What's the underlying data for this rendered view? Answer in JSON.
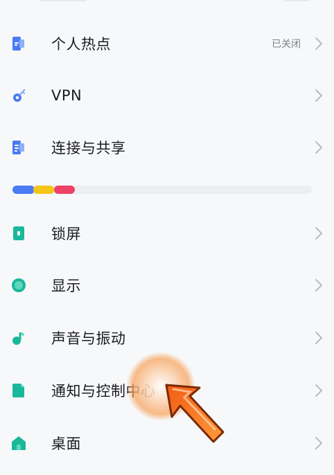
{
  "settings": {
    "section_network": [
      {
        "label": "个人热点",
        "status": "已关闭",
        "icon": "hotspot-icon",
        "color": "#4a7bf3"
      },
      {
        "label": "VPN",
        "status": "",
        "icon": "vpn-key-icon",
        "color": "#4a7bf3"
      },
      {
        "label": "连接与共享",
        "status": "",
        "icon": "connection-share-icon",
        "color": "#4a7bf3"
      }
    ],
    "section_display": [
      {
        "label": "锁屏",
        "status": "",
        "icon": "lock-screen-icon",
        "color": "#1ab89a"
      },
      {
        "label": "显示",
        "status": "",
        "icon": "display-icon",
        "color": "#1ab89a"
      },
      {
        "label": "声音与振动",
        "status": "",
        "icon": "sound-vibration-icon",
        "color": "#1ab89a"
      },
      {
        "label": "通知与控制中心",
        "status": "",
        "icon": "notification-control-icon",
        "color": "#1ab89a"
      },
      {
        "label": "桌面",
        "status": "",
        "icon": "home-desktop-icon",
        "color": "#1ab89a"
      }
    ]
  },
  "divider_colors": [
    "#4a7bf3",
    "#f5c518",
    "#ee4266"
  ],
  "chevron_color": "#b8bbc2",
  "overlay": {
    "icon": "tap-pointer-arrow-icon",
    "glow_color": "#f7a561",
    "arrow_color": "#f25c14"
  }
}
